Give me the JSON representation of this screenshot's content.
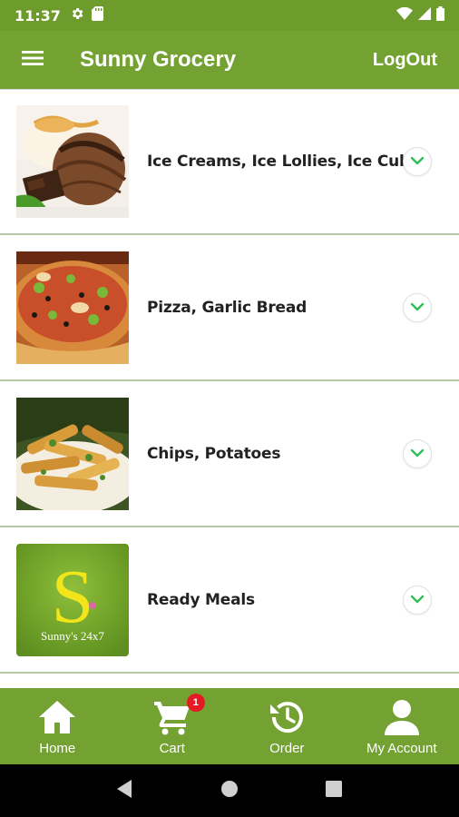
{
  "status_bar": {
    "time": "11:37",
    "icons_left": [
      "settings-gear-icon",
      "sd-card-icon"
    ],
    "icons_right": [
      "wifi-icon",
      "signal-icon",
      "battery-icon"
    ]
  },
  "app_bar": {
    "title": "Sunny Grocery",
    "logout_label": "LogOut",
    "menu_icon": "hamburger-menu-icon"
  },
  "categories": [
    {
      "label": "Ice Creams, Ice Lollies, Ice Cubes",
      "image": "ice-cream-photo"
    },
    {
      "label": "Pizza, Garlic Bread",
      "image": "pizza-photo"
    },
    {
      "label": "Chips, Potatoes",
      "image": "chips-photo"
    },
    {
      "label": "Ready Meals",
      "image": "sunny-logo",
      "logo_letter": "S",
      "logo_text": "Sunny's 24x7"
    }
  ],
  "bottom_nav": {
    "items": [
      {
        "label": "Home",
        "icon": "home-icon"
      },
      {
        "label": "Cart",
        "icon": "cart-icon",
        "badge": "1"
      },
      {
        "label": "Order",
        "icon": "order-history-icon"
      },
      {
        "label": "My Account",
        "icon": "account-icon"
      }
    ]
  },
  "colors": {
    "primary": "#73a232",
    "status_bar": "#6d9b2c",
    "expand_chevron": "#2fbf55",
    "badge": "#e41b23",
    "divider": "#b6c7a3"
  }
}
